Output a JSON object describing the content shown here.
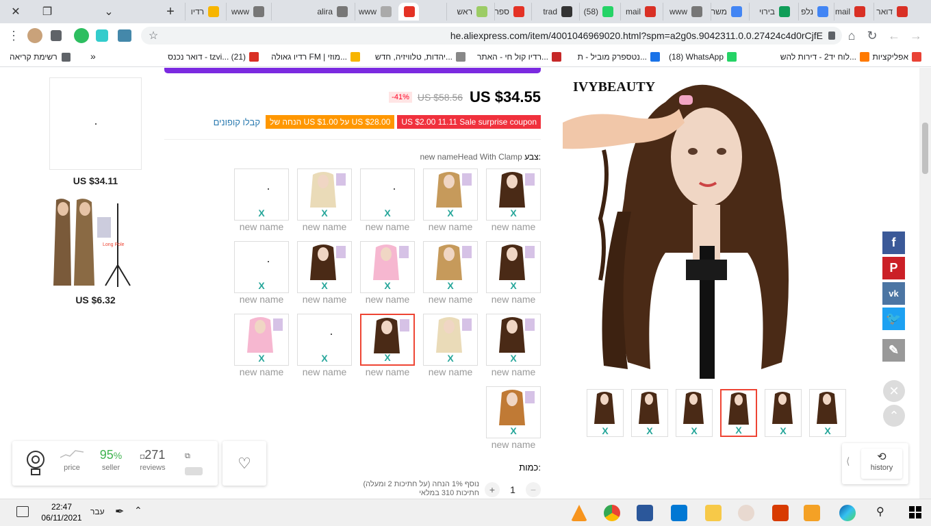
{
  "browser": {
    "tabs": [
      {
        "label": "דואר",
        "icon": "gmail-icon",
        "color": "#d93025"
      },
      {
        "label": "mail",
        "icon": "gmail-icon",
        "color": "#d93025"
      },
      {
        "label": "נלפ",
        "icon": "docs-icon",
        "color": "#4285f4"
      },
      {
        "label": "בירוי",
        "icon": "sheets-icon",
        "color": "#0f9d58"
      },
      {
        "label": "משר",
        "icon": "docs-icon",
        "color": "#4285f4"
      },
      {
        "label": "www",
        "icon": "puzzle-icon",
        "color": "#777777"
      },
      {
        "label": "mail",
        "icon": "gmail-icon",
        "color": "#d93025"
      },
      {
        "label": "(58)",
        "icon": "whatsapp-icon",
        "color": "#25d366"
      },
      {
        "label": "trad",
        "icon": "tradingview-icon",
        "color": "#333333"
      },
      {
        "label": "ספר",
        "icon": "aliexpress-icon",
        "color": "#e43225"
      },
      {
        "label": "ראש",
        "icon": "grammarly-icon",
        "color": "#9ccc65"
      },
      {
        "label": "",
        "icon": "aliexpress-icon",
        "color": "#e43225"
      },
      {
        "label": "www",
        "icon": "grammarly-icon",
        "color": "#aaaaaa"
      },
      {
        "label": "www",
        "icon": "grammarly-icon",
        "color": "#aaaaaa"
      },
      {
        "label": "alira",
        "icon": "globe-icon",
        "color": "#777777"
      },
      {
        "label": "www",
        "icon": "puzzle-icon",
        "color": "#777777"
      },
      {
        "label": "רדיו",
        "icon": "radio-icon",
        "color": "#f7b500"
      }
    ],
    "url": "he.aliexpress.com/item/4001046969020.html?spm=a2g0s.9042311.0.0.27424c4d0rCjfE",
    "bookmarks": [
      {
        "label": "אפליקציות",
        "color": "#e94235"
      },
      {
        "label": "לוח יד2 - דירות להש...",
        "color": "#ff7a00"
      },
      {
        "label": "(18) WhatsApp",
        "color": "#25d366"
      },
      {
        "label": "נטספרק מוביל - ת...",
        "color": "#1a73e8"
      },
      {
        "label": "רדיו קול חי - האתר...",
        "color": "#c62828"
      },
      {
        "label": "יהדות, טלוויזיה, חדש...",
        "color": "#888888"
      },
      {
        "label": "רדיו גאולה FM | מוזי...",
        "color": "#f7b500"
      },
      {
        "label": "דואר נכנס - tzvi... (21)",
        "color": "#d93025"
      }
    ],
    "reading_list": "רשימת קריאה",
    "more_bookmarks": "»"
  },
  "product": {
    "price": "US $34.55",
    "old_price": "US $58.56",
    "discount": "-41%",
    "coupons": [
      {
        "text": "US $2.00 11.11 Sale surprise coupon",
        "color": "#f0313d"
      },
      {
        "text": "הנחה של US $1.00 על US $28.00",
        "color": "#ff9700"
      }
    ],
    "get_coupons": "קבלו קופונים",
    "color_label": "צבע:",
    "color_value": "new nameHead With Clamp",
    "swatch_x": "X",
    "swatch_name": "new name",
    "quantity_label": "כמות:",
    "quantity": "1",
    "quantity_note_1": "נוסף 1% הנחה (על חתיכות 2 ומעלה)",
    "quantity_note_2": "חתיכות 310 במלאי",
    "main_image_logo": "IVYBEAUTY",
    "thumb_x": "X"
  },
  "recommendations": [
    {
      "price": "US $34.11"
    },
    {
      "price": "US $6.32"
    }
  ],
  "store_info": {
    "price_label": "price",
    "seller_value": "95",
    "seller_unit": "%",
    "seller_label": "seller",
    "reviews_value": "271",
    "reviews_label": "reviews"
  },
  "history_label": "history",
  "taskbar": {
    "time": "22:47",
    "date": "06/11/2021",
    "lang": "עבר"
  }
}
